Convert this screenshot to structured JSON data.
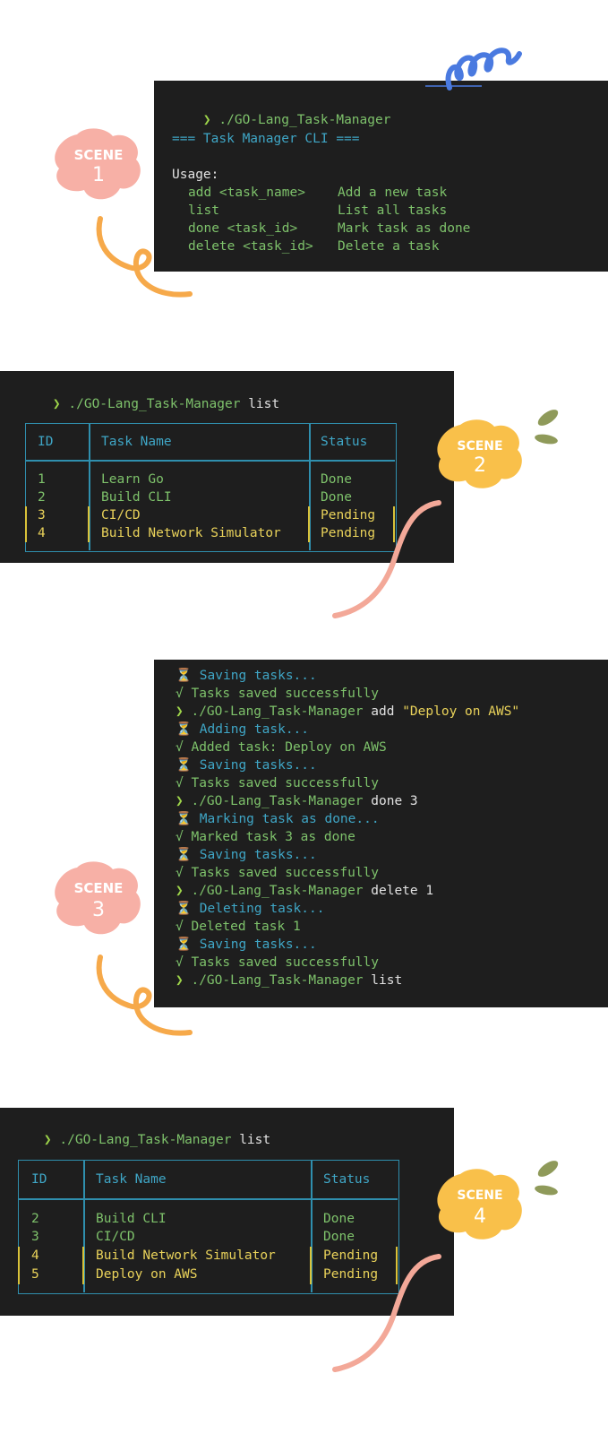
{
  "scene1": {
    "badge_word": "SCENE",
    "badge_num": "1",
    "prompt_arrow": "❯",
    "command": "./GO-Lang_Task-Manager",
    "banner": "=== Task Manager CLI ===",
    "usage_label": "Usage:",
    "usage": [
      {
        "cmd": "add <task_name>",
        "desc": "Add a new task"
      },
      {
        "cmd": "list",
        "desc": "List all tasks"
      },
      {
        "cmd": "done <task_id>",
        "desc": "Mark task as done"
      },
      {
        "cmd": "delete <task_id>",
        "desc": "Delete a task"
      }
    ]
  },
  "scene2": {
    "badge_word": "SCENE",
    "badge_num": "2",
    "prompt_arrow": "❯",
    "command": "./GO-Lang_Task-Manager",
    "arg": "list",
    "headers": {
      "id": "ID",
      "name": "Task Name",
      "status": "Status"
    },
    "rows": [
      {
        "id": "1",
        "name": "Learn Go",
        "status": "Done"
      },
      {
        "id": "2",
        "name": "Build CLI",
        "status": "Done"
      },
      {
        "id": "3",
        "name": "CI/CD",
        "status": "Pending"
      },
      {
        "id": "4",
        "name": "Build Network Simulator",
        "status": "Pending"
      }
    ]
  },
  "scene3": {
    "badge_word": "SCENE",
    "badge_num": "3",
    "hourglass": "⏳",
    "check": "√",
    "prompt_arrow": "❯",
    "l1": "Saving tasks...",
    "l2": "Tasks saved successfully",
    "l3_cmd": "./GO-Lang_Task-Manager",
    "l3_arg": "add",
    "l3_str": "\"Deploy on AWS\"",
    "l4": "Adding task...",
    "l5": "Added task: Deploy on AWS",
    "l6": "Saving tasks...",
    "l7": "Tasks saved successfully",
    "l8_cmd": "./GO-Lang_Task-Manager",
    "l8_arg": "done 3",
    "l9": "Marking task as done...",
    "l10": "Marked task 3 as done",
    "l11": "Saving tasks...",
    "l12": "Tasks saved successfully",
    "l13_cmd": "./GO-Lang_Task-Manager",
    "l13_arg": "delete 1",
    "l14": "Deleting task...",
    "l15": "Deleted task 1",
    "l16": "Saving tasks...",
    "l17": "Tasks saved successfully",
    "l18_cmd": "./GO-Lang_Task-Manager",
    "l18_arg": "list"
  },
  "scene4": {
    "badge_word": "SCENE",
    "badge_num": "4",
    "prompt_arrow": "❯",
    "command": "./GO-Lang_Task-Manager",
    "arg": "list",
    "headers": {
      "id": "ID",
      "name": "Task Name",
      "status": "Status"
    },
    "rows": [
      {
        "id": "2",
        "name": "Build CLI",
        "status": "Done"
      },
      {
        "id": "3",
        "name": "CI/CD",
        "status": "Done"
      },
      {
        "id": "4",
        "name": "Build Network Simulator",
        "status": "Pending"
      },
      {
        "id": "5",
        "name": "Deploy on AWS",
        "status": "Pending"
      }
    ]
  },
  "colors": {
    "terminal_bg": "#1e1e1e",
    "prompt_green": "#9ed54a",
    "text_green": "#7ec26b",
    "text_cyan": "#3fa6c6",
    "text_yellow": "#e9d25a",
    "table_border": "#2f8fae",
    "badge_pink": "#f7b0a6",
    "badge_yellow": "#f9c04a",
    "squiggle_orange": "#f6a94a",
    "squiggle_pink": "#f3a898",
    "swirl_blue": "#4a7ae0",
    "leaf_green": "#8f9a5a"
  }
}
